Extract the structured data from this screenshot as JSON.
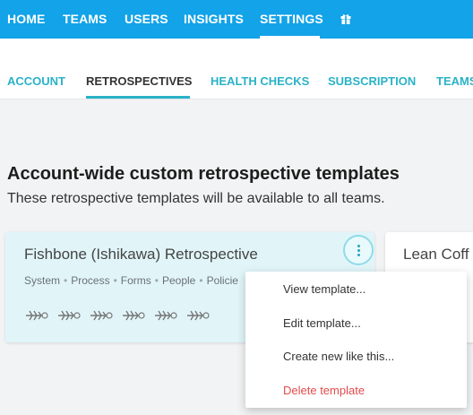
{
  "topnav": {
    "items": [
      "HOME",
      "TEAMS",
      "USERS",
      "INSIGHTS",
      "SETTINGS"
    ],
    "active": "SETTINGS",
    "extra_icon": "gift-icon"
  },
  "subnav": {
    "tabs": [
      "ACCOUNT",
      "RETROSPECTIVES",
      "HEALTH CHECKS",
      "SUBSCRIPTION",
      "TEAMS"
    ],
    "active": "RETROSPECTIVES"
  },
  "section": {
    "title": "Account-wide custom retrospective templates",
    "description": "These retrospective templates will be available to all teams."
  },
  "cards": [
    {
      "title": "Fishbone (Ishikawa) Retrospective",
      "tags": [
        "System",
        "Process",
        "Forms",
        "People",
        "Policie"
      ],
      "icon": "fishbone-icon"
    },
    {
      "title": "Lean Coff"
    }
  ],
  "menu": {
    "items": [
      {
        "label": "View template...",
        "danger": false
      },
      {
        "label": "Edit template...",
        "danger": false
      },
      {
        "label": "Create new like this...",
        "danger": false
      },
      {
        "label": "Delete template",
        "danger": true
      }
    ]
  },
  "colors": {
    "topnav": "#12a3e8",
    "accent": "#2ab2c7",
    "card": "#e1f5f9",
    "danger": "#e34b4b"
  }
}
